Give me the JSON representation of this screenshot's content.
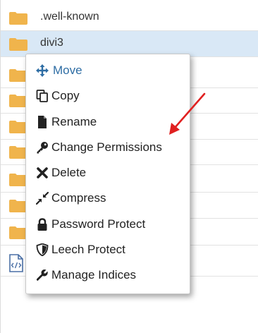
{
  "files": [
    {
      "name": ".well-known",
      "icon": "folder-icon",
      "selected": false
    },
    {
      "name": "divi3",
      "icon": "folder-icon",
      "selected": true
    },
    {
      "name": "",
      "icon": "folder-icon",
      "selected": false
    },
    {
      "name": "",
      "icon": "folder-icon",
      "selected": false
    },
    {
      "name": "",
      "icon": "folder-icon",
      "selected": false
    },
    {
      "name": "",
      "icon": "folder-icon",
      "selected": false
    },
    {
      "name": "",
      "icon": "folder-icon",
      "selected": false
    },
    {
      "name": "",
      "icon": "folder-icon",
      "selected": false
    },
    {
      "name": "",
      "icon": "folder-icon",
      "selected": false
    },
    {
      "name": "",
      "icon": "code-file-icon",
      "selected": false
    }
  ],
  "context_menu": {
    "items": [
      {
        "label": "Move",
        "icon": "move-icon"
      },
      {
        "label": "Copy",
        "icon": "copy-icon"
      },
      {
        "label": "Rename",
        "icon": "file-icon"
      },
      {
        "label": "Change Permissions",
        "icon": "key-icon"
      },
      {
        "label": "Delete",
        "icon": "x-icon"
      },
      {
        "label": "Compress",
        "icon": "compress-icon"
      },
      {
        "label": "Password Protect",
        "icon": "lock-icon"
      },
      {
        "label": "Leech Protect",
        "icon": "shield-icon"
      },
      {
        "label": "Manage Indices",
        "icon": "wrench-icon"
      }
    ]
  },
  "colors": {
    "folder": "#f0b44c",
    "selected_row": "#d9e8f6",
    "move_accent": "#2e6da4",
    "annotation_arrow": "#e02020"
  }
}
